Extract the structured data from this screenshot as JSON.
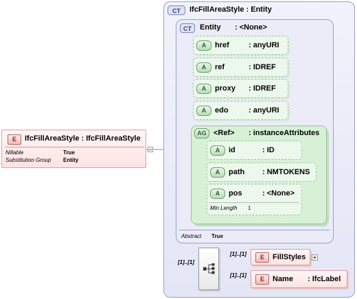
{
  "outer": {
    "badge": "CT",
    "title": "IfcFillAreaStyle : Entity"
  },
  "inner": {
    "badge": "CT",
    "name": "Entity",
    "type": ": <None>"
  },
  "attributes": [
    {
      "badge": "A",
      "name": "href",
      "type": ": anyURI"
    },
    {
      "badge": "A",
      "name": "ref",
      "type": ": IDREF"
    },
    {
      "badge": "A",
      "name": "proxy",
      "type": ": IDREF"
    },
    {
      "badge": "A",
      "name": "edo",
      "type": ": anyURI"
    }
  ],
  "attribute_group": {
    "badge": "AG",
    "name": "<Ref>",
    "type": ": instanceAttributes",
    "items": [
      {
        "badge": "A",
        "name": "id",
        "type": ": ID"
      },
      {
        "badge": "A",
        "name": "path",
        "type": ": NMTOKENS"
      },
      {
        "badge": "A",
        "name": "pos",
        "type": ": <None>",
        "facet_label": "Min Length",
        "facet_value": "1"
      }
    ]
  },
  "abstract": {
    "label": "Abstract",
    "value": "True"
  },
  "main_element": {
    "badge": "E",
    "title": "IfcFillAreaStyle : IfcFillAreaStyle",
    "props": [
      {
        "label": "Nillable",
        "value": "True"
      },
      {
        "label": "Substitution Group",
        "value": "Entity"
      }
    ]
  },
  "sequence": {
    "cardinality": "[1]..[1]"
  },
  "children": [
    {
      "badge": "E",
      "name": "FillStyles",
      "type": "",
      "cardinality": "[1]..[1]"
    },
    {
      "badge": "E",
      "name": "Name",
      "type": ": IfcLabel",
      "cardinality": "[1]..[1]"
    }
  ]
}
